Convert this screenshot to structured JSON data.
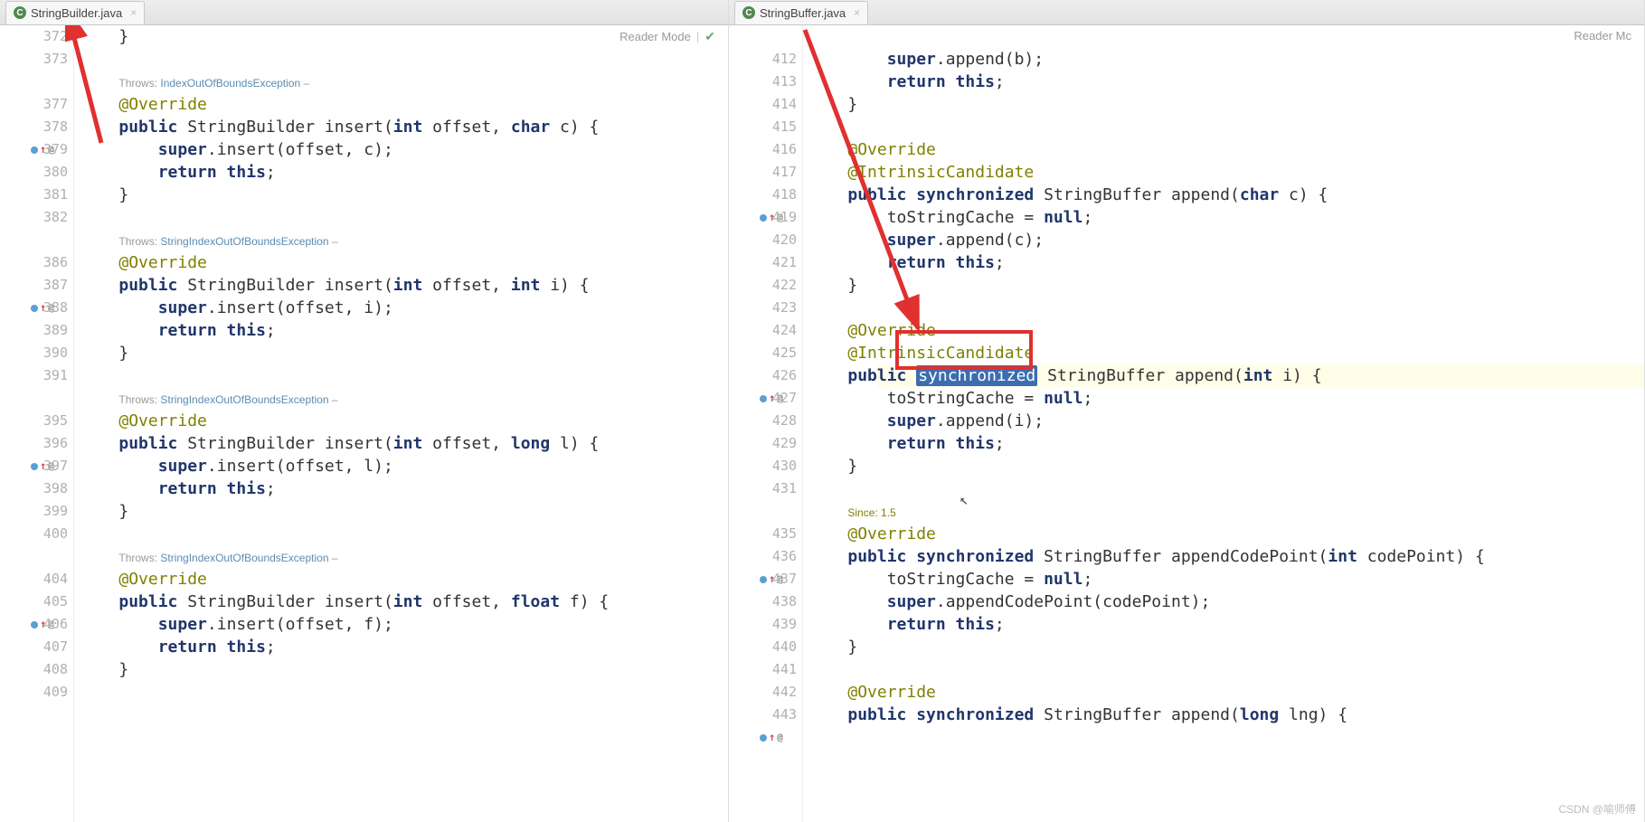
{
  "readerMode": "Reader Mode",
  "readerModeShort": "Reader Mc",
  "watermark": "CSDN @喻师傅",
  "left": {
    "tab": "StringBuilder.java",
    "linenos": [
      "372",
      "373",
      "",
      "377",
      "378",
      "379",
      "380",
      "381",
      "382",
      "",
      "386",
      "387",
      "388",
      "389",
      "390",
      "391",
      "",
      "395",
      "396",
      "397",
      "398",
      "399",
      "400",
      "",
      "404",
      "405",
      "406",
      "407",
      "408",
      "409"
    ],
    "lines": [
      {
        "indent": 1,
        "t": [
          {
            "txt": "}"
          }
        ]
      },
      {
        "indent": 0,
        "t": []
      },
      {
        "hint": true,
        "pre": "Throws: ",
        "link": "IndexOutOfBoundsException",
        "post": " – "
      },
      {
        "indent": 1,
        "t": [
          {
            "cls": "ann",
            "txt": "@Override"
          }
        ]
      },
      {
        "marker": true,
        "indent": 1,
        "t": [
          {
            "cls": "kw",
            "txt": "public "
          },
          {
            "txt": "StringBuilder insert("
          },
          {
            "cls": "kw",
            "txt": "int "
          },
          {
            "txt": "offset, "
          },
          {
            "cls": "kw",
            "txt": "char "
          },
          {
            "txt": "c) {"
          }
        ]
      },
      {
        "indent": 2,
        "t": [
          {
            "cls": "kw",
            "txt": "super"
          },
          {
            "txt": ".insert(offset, c);"
          }
        ]
      },
      {
        "indent": 2,
        "t": [
          {
            "cls": "kw",
            "txt": "return this"
          },
          {
            "txt": ";"
          }
        ]
      },
      {
        "indent": 1,
        "t": [
          {
            "txt": "}"
          }
        ]
      },
      {
        "indent": 0,
        "t": []
      },
      {
        "hint": true,
        "pre": "Throws: ",
        "link": "StringIndexOutOfBoundsException",
        "post": " – "
      },
      {
        "indent": 1,
        "t": [
          {
            "cls": "ann",
            "txt": "@Override"
          }
        ]
      },
      {
        "marker": true,
        "indent": 1,
        "t": [
          {
            "cls": "kw",
            "txt": "public "
          },
          {
            "txt": "StringBuilder insert("
          },
          {
            "cls": "kw",
            "txt": "int "
          },
          {
            "txt": "offset, "
          },
          {
            "cls": "kw",
            "txt": "int "
          },
          {
            "txt": "i) {"
          }
        ]
      },
      {
        "indent": 2,
        "t": [
          {
            "cls": "kw",
            "txt": "super"
          },
          {
            "txt": ".insert(offset, i);"
          }
        ]
      },
      {
        "indent": 2,
        "t": [
          {
            "cls": "kw",
            "txt": "return this"
          },
          {
            "txt": ";"
          }
        ]
      },
      {
        "indent": 1,
        "t": [
          {
            "txt": "}"
          }
        ]
      },
      {
        "indent": 0,
        "t": []
      },
      {
        "hint": true,
        "pre": "Throws: ",
        "link": "StringIndexOutOfBoundsException",
        "post": " – "
      },
      {
        "indent": 1,
        "t": [
          {
            "cls": "ann",
            "txt": "@Override"
          }
        ]
      },
      {
        "marker": true,
        "indent": 1,
        "t": [
          {
            "cls": "kw",
            "txt": "public "
          },
          {
            "txt": "StringBuilder insert("
          },
          {
            "cls": "kw",
            "txt": "int "
          },
          {
            "txt": "offset, "
          },
          {
            "cls": "kw",
            "txt": "long "
          },
          {
            "txt": "l) {"
          }
        ]
      },
      {
        "indent": 2,
        "t": [
          {
            "cls": "kw",
            "txt": "super"
          },
          {
            "txt": ".insert(offset, l);"
          }
        ]
      },
      {
        "indent": 2,
        "t": [
          {
            "cls": "kw",
            "txt": "return this"
          },
          {
            "txt": ";"
          }
        ]
      },
      {
        "indent": 1,
        "t": [
          {
            "txt": "}"
          }
        ]
      },
      {
        "indent": 0,
        "t": []
      },
      {
        "hint": true,
        "pre": "Throws: ",
        "link": "StringIndexOutOfBoundsException",
        "post": " – "
      },
      {
        "indent": 1,
        "t": [
          {
            "cls": "ann",
            "txt": "@Override"
          }
        ]
      },
      {
        "marker": true,
        "indent": 1,
        "t": [
          {
            "cls": "kw",
            "txt": "public "
          },
          {
            "txt": "StringBuilder insert("
          },
          {
            "cls": "kw",
            "txt": "int "
          },
          {
            "txt": "offset, "
          },
          {
            "cls": "kw",
            "txt": "float "
          },
          {
            "txt": "f) {"
          }
        ]
      },
      {
        "indent": 2,
        "t": [
          {
            "cls": "kw",
            "txt": "super"
          },
          {
            "txt": ".insert(offset, f);"
          }
        ]
      },
      {
        "indent": 2,
        "t": [
          {
            "cls": "kw",
            "txt": "return this"
          },
          {
            "txt": ";"
          }
        ]
      },
      {
        "indent": 1,
        "t": [
          {
            "txt": "}"
          }
        ]
      },
      {
        "indent": 0,
        "t": []
      }
    ]
  },
  "right": {
    "tab": "StringBuffer.java",
    "linenos": [
      "",
      "412",
      "413",
      "414",
      "415",
      "416",
      "417",
      "418",
      "419",
      "420",
      "421",
      "422",
      "423",
      "424",
      "425",
      "426",
      "427",
      "428",
      "429",
      "430",
      "431",
      "",
      "435",
      "436",
      "437",
      "438",
      "439",
      "440",
      "441",
      "442",
      "443"
    ],
    "lines": [
      {
        "indent": 0,
        "t": []
      },
      {
        "indent": 2,
        "t": [
          {
            "cls": "kw",
            "txt": "super"
          },
          {
            "txt": ".append(b);"
          }
        ]
      },
      {
        "indent": 2,
        "t": [
          {
            "cls": "kw",
            "txt": "return this"
          },
          {
            "txt": ";"
          }
        ]
      },
      {
        "indent": 1,
        "t": [
          {
            "txt": "}"
          }
        ]
      },
      {
        "indent": 0,
        "t": []
      },
      {
        "indent": 1,
        "t": [
          {
            "cls": "ann",
            "txt": "@Override"
          }
        ]
      },
      {
        "indent": 1,
        "t": [
          {
            "cls": "ann",
            "txt": "@IntrinsicCandidate"
          }
        ]
      },
      {
        "marker": true,
        "indent": 1,
        "t": [
          {
            "cls": "kw",
            "txt": "public synchronized "
          },
          {
            "txt": "StringBuffer append("
          },
          {
            "cls": "kw",
            "txt": "char "
          },
          {
            "txt": "c) {"
          }
        ]
      },
      {
        "indent": 2,
        "t": [
          {
            "txt": "toStringCache = "
          },
          {
            "cls": "kw",
            "txt": "null"
          },
          {
            "txt": ";"
          }
        ]
      },
      {
        "indent": 2,
        "t": [
          {
            "cls": "kw",
            "txt": "super"
          },
          {
            "txt": ".append(c);"
          }
        ]
      },
      {
        "indent": 2,
        "t": [
          {
            "cls": "kw",
            "txt": "return this"
          },
          {
            "txt": ";"
          }
        ]
      },
      {
        "indent": 1,
        "t": [
          {
            "txt": "}"
          }
        ]
      },
      {
        "indent": 0,
        "t": []
      },
      {
        "indent": 1,
        "t": [
          {
            "cls": "ann",
            "txt": "@Override"
          }
        ]
      },
      {
        "indent": 1,
        "t": [
          {
            "cls": "ann",
            "txt": "@IntrinsicCandidate"
          }
        ]
      },
      {
        "marker": true,
        "highlight": true,
        "indent": 1,
        "t": [
          {
            "cls": "kw",
            "txt": "public "
          },
          {
            "sel": true,
            "txt": "synchronized"
          },
          {
            "cls": "kw",
            "txt": " "
          },
          {
            "txt": "StringBuffer append("
          },
          {
            "cls": "kw",
            "txt": "int "
          },
          {
            "txt": "i) {"
          }
        ]
      },
      {
        "indent": 2,
        "t": [
          {
            "txt": "toStringCache = "
          },
          {
            "cls": "kw",
            "txt": "null"
          },
          {
            "txt": ";"
          }
        ]
      },
      {
        "indent": 2,
        "t": [
          {
            "cls": "kw",
            "txt": "super"
          },
          {
            "txt": ".append(i);"
          }
        ]
      },
      {
        "indent": 2,
        "t": [
          {
            "cls": "kw",
            "txt": "return this"
          },
          {
            "txt": ";"
          }
        ]
      },
      {
        "indent": 1,
        "t": [
          {
            "txt": "}"
          }
        ]
      },
      {
        "indent": 0,
        "t": []
      },
      {
        "since": true,
        "txt": "Since: 1.5"
      },
      {
        "indent": 1,
        "t": [
          {
            "cls": "ann",
            "txt": "@Override"
          }
        ]
      },
      {
        "marker": true,
        "indent": 1,
        "t": [
          {
            "cls": "kw",
            "txt": "public synchronized "
          },
          {
            "txt": "StringBuffer appendCodePoint("
          },
          {
            "cls": "kw",
            "txt": "int "
          },
          {
            "txt": "codePoint) {"
          }
        ]
      },
      {
        "indent": 2,
        "t": [
          {
            "txt": "toStringCache = "
          },
          {
            "cls": "kw",
            "txt": "null"
          },
          {
            "txt": ";"
          }
        ]
      },
      {
        "indent": 2,
        "t": [
          {
            "cls": "kw",
            "txt": "super"
          },
          {
            "txt": ".appendCodePoint(codePoint);"
          }
        ]
      },
      {
        "indent": 2,
        "t": [
          {
            "cls": "kw",
            "txt": "return this"
          },
          {
            "txt": ";"
          }
        ]
      },
      {
        "indent": 1,
        "t": [
          {
            "txt": "}"
          }
        ]
      },
      {
        "indent": 0,
        "t": []
      },
      {
        "indent": 1,
        "t": [
          {
            "cls": "ann",
            "txt": "@Override"
          }
        ]
      },
      {
        "marker": true,
        "indent": 1,
        "t": [
          {
            "cls": "kw",
            "txt": "public synchronized "
          },
          {
            "txt": "StringBuffer append("
          },
          {
            "cls": "kw",
            "txt": "long "
          },
          {
            "txt": "lng) {"
          }
        ]
      }
    ]
  }
}
